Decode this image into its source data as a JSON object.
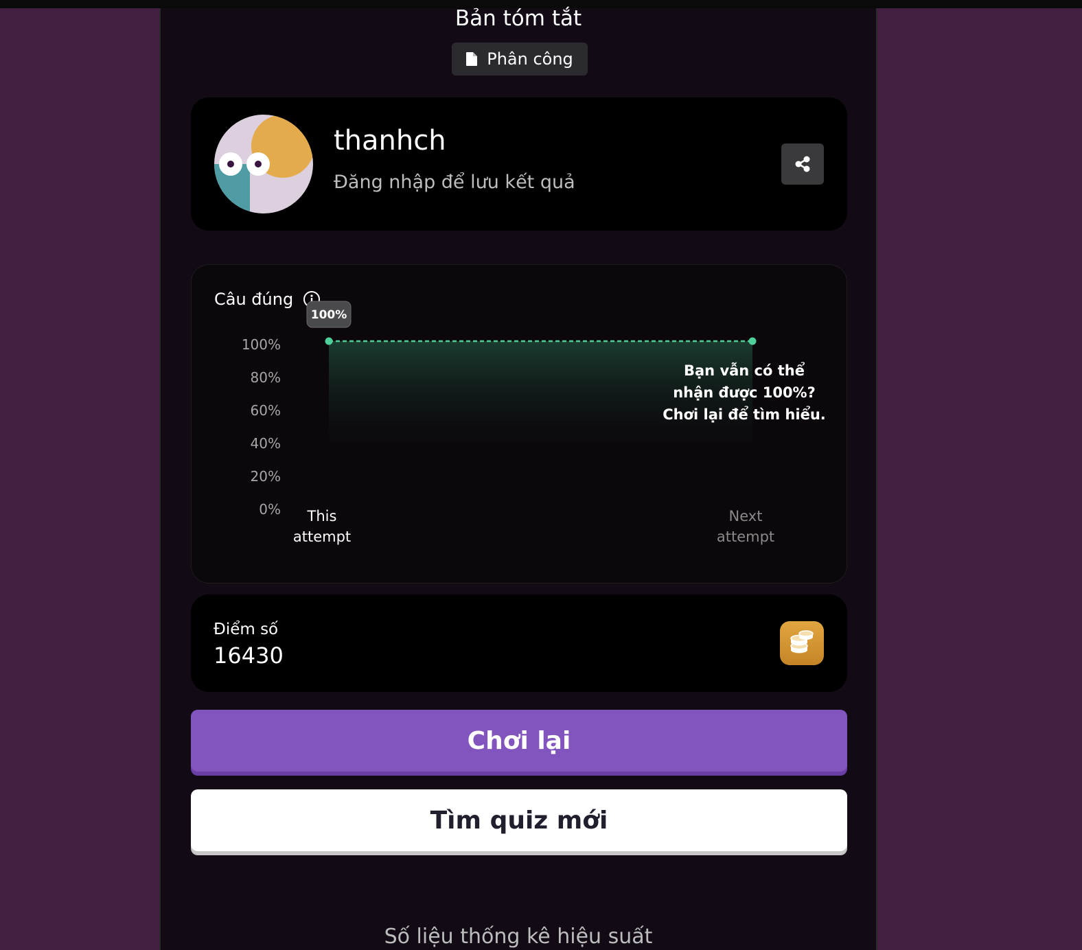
{
  "header": {
    "title": "Bản tóm tắt",
    "assignment_label": "Phân công"
  },
  "profile": {
    "username": "thanhch",
    "login_hint": "Đăng nhập để lưu kết quả"
  },
  "accuracy": {
    "title": "Câu đúng",
    "tooltip_value": "100%",
    "retry_message": [
      "Bạn vẫn có thể",
      "nhận được 100%?",
      "Chơi lại để tìm hiểu."
    ]
  },
  "score": {
    "label": "Điểm số",
    "value": "16430"
  },
  "actions": {
    "replay_label": "Chơi lại",
    "new_quiz_label": "Tìm quiz mới"
  },
  "stats": {
    "heading": "Số liệu thống kê hiệu suất"
  },
  "colors": {
    "accent_purple": "#8254bd",
    "line_green": "#4fcf9a",
    "coin_gold": "#e0a640",
    "page_bg": "#421e40"
  },
  "chart_data": {
    "type": "area",
    "title": "Câu đúng",
    "categories": [
      "This attempt",
      "Next attempt"
    ],
    "x_tick_labels": [
      [
        "This",
        "attempt"
      ],
      [
        "Next",
        "attempt"
      ]
    ],
    "values": [
      100,
      100
    ],
    "y_ticks": [
      "100%",
      "80%",
      "60%",
      "40%",
      "20%",
      "0%"
    ],
    "ylim": [
      0,
      100
    ],
    "grid": false,
    "legend": "none",
    "data_labels": [
      "100%"
    ]
  }
}
